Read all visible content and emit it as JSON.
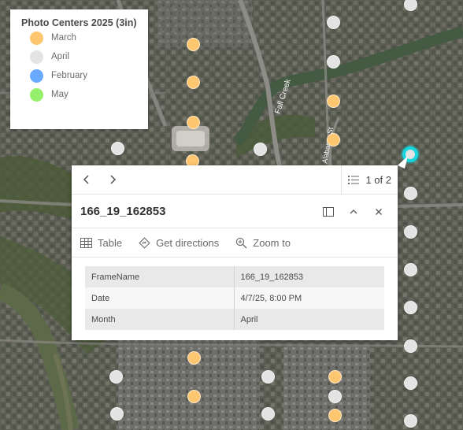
{
  "legend": {
    "title": "Photo Centers 2025 (3in)",
    "items": [
      {
        "label": "March",
        "color": "#ffc670"
      },
      {
        "label": "April",
        "color": "#e3e3e3"
      },
      {
        "label": "February",
        "color": "#69a9ff"
      },
      {
        "label": "May",
        "color": "#96f06e"
      }
    ]
  },
  "map_labels": {
    "river": "Fall Creek",
    "street": "Alabama St"
  },
  "popup": {
    "prev_icon": "chevron-left-icon",
    "next_icon": "chevron-right-icon",
    "count": "1 of 2",
    "title": "166_19_162853",
    "actions": [
      {
        "label": "Table",
        "icon": "table-icon"
      },
      {
        "label": "Get directions",
        "icon": "directions-icon"
      },
      {
        "label": "Zoom to",
        "icon": "zoom-to-icon"
      }
    ],
    "fields": [
      {
        "key": "FrameName",
        "value": "166_19_162853"
      },
      {
        "key": "Date",
        "value": "4/7/25, 8:00 PM"
      },
      {
        "key": "Month",
        "value": "April"
      }
    ]
  },
  "selection_color": "#16d6e0"
}
